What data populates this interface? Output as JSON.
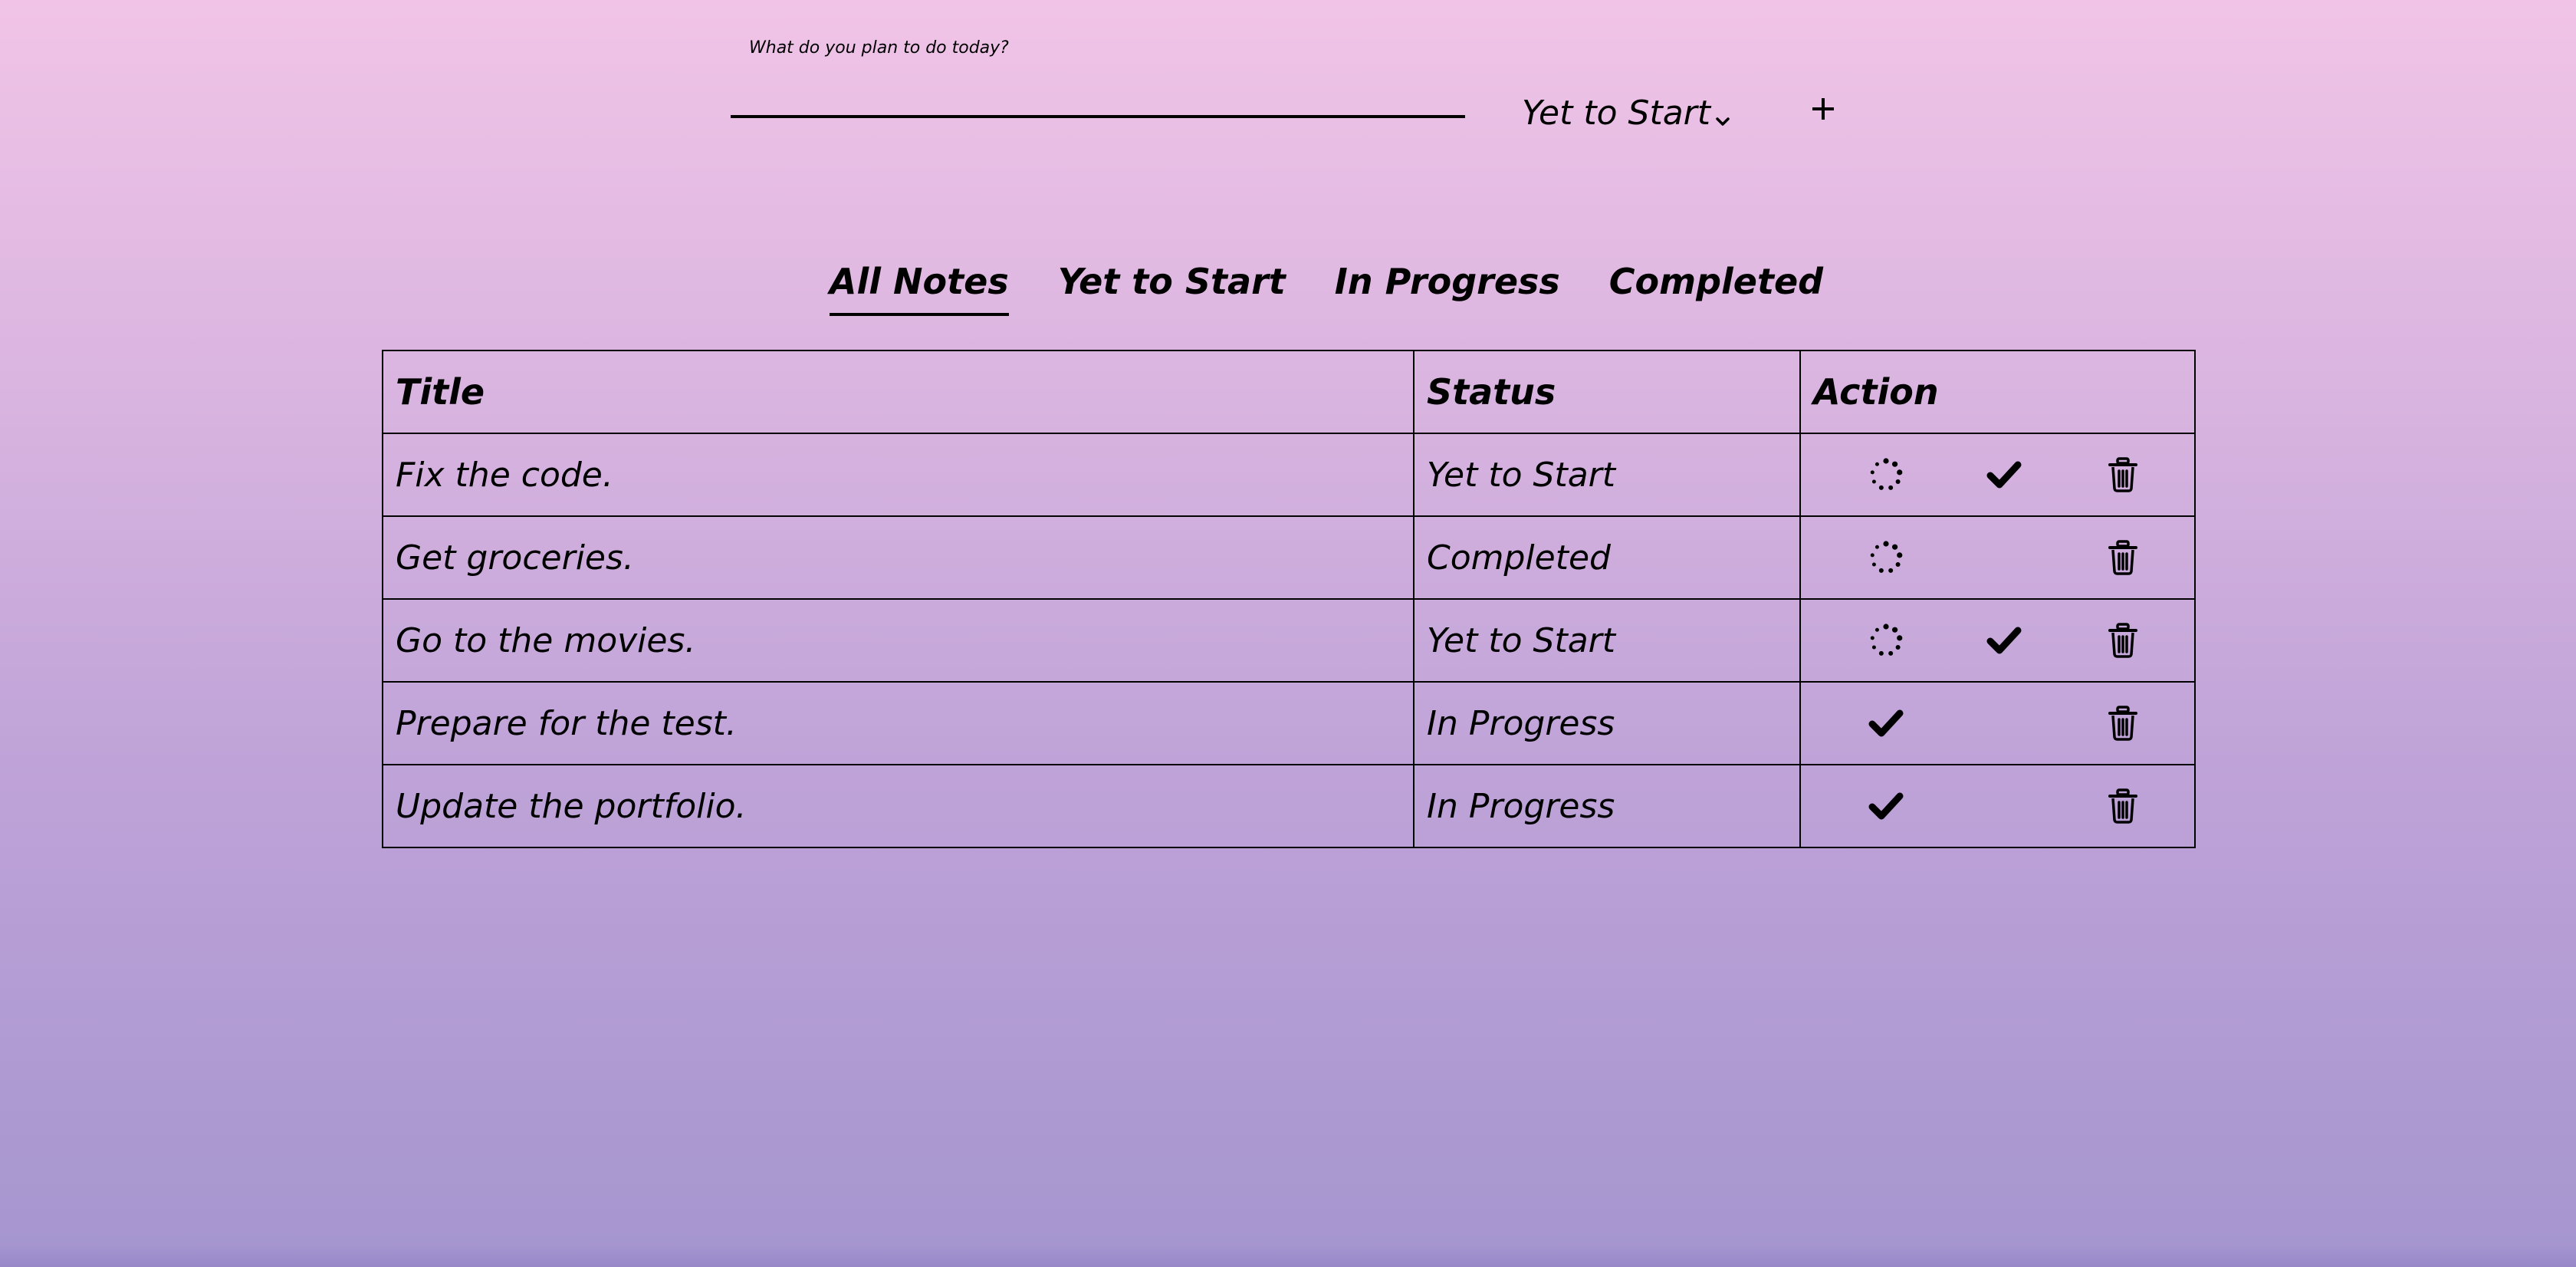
{
  "form": {
    "label": "What do you plan to do today?",
    "input_value": "",
    "input_placeholder": "",
    "status_selected": "Yet to Start",
    "add_label": "+"
  },
  "tabs": [
    {
      "label": "All Notes",
      "active": true
    },
    {
      "label": "Yet to Start",
      "active": false
    },
    {
      "label": "In Progress",
      "active": false
    },
    {
      "label": "Completed",
      "active": false
    }
  ],
  "table": {
    "headers": {
      "title": "Title",
      "status": "Status",
      "action": "Action"
    },
    "rows": [
      {
        "title": "Fix the code.",
        "status": "Yet to Start",
        "actions": [
          "in-progress-icon",
          "check-icon",
          "trash-icon"
        ]
      },
      {
        "title": "Get groceries.",
        "status": "Completed",
        "actions": [
          "in-progress-icon",
          "",
          "trash-icon"
        ]
      },
      {
        "title": "Go to the movies.",
        "status": "Yet to Start",
        "actions": [
          "in-progress-icon",
          "check-icon",
          "trash-icon"
        ]
      },
      {
        "title": "Prepare for the test.",
        "status": "In Progress",
        "actions": [
          "check-icon",
          "",
          "trash-icon"
        ]
      },
      {
        "title": "Update the portfolio.",
        "status": "In Progress",
        "actions": [
          "check-icon",
          "",
          "trash-icon"
        ]
      }
    ]
  },
  "colors": {
    "gradient_top": "#f1c4e7",
    "gradient_bottom": "#a595cf",
    "ink": "#000000"
  }
}
